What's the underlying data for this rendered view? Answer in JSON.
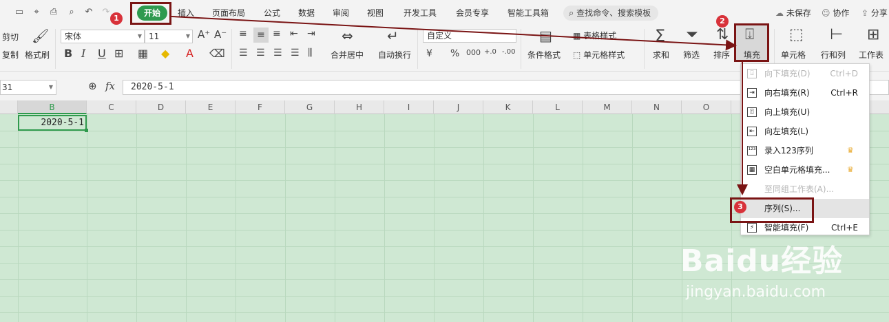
{
  "tabs": {
    "home": "开始",
    "insert": "插入",
    "page_layout": "页面布局",
    "formula": "公式",
    "data": "数据",
    "review": "审阅",
    "view": "视图",
    "developer": "开发工具",
    "member": "会员专享",
    "smart_toolbox": "智能工具箱"
  },
  "search": {
    "label": "查找命令、搜索模板"
  },
  "right_tools": {
    "unsaved": "未保存",
    "collab": "协作",
    "share": "分享"
  },
  "ribbon": {
    "cut": "剪切",
    "copy": "复制",
    "format_painter": "格式刷",
    "font_name": "宋体",
    "font_size": "11",
    "merge_center": "合并居中",
    "wrap_text": "自动换行",
    "number_format": "自定义",
    "conditional_format": "条件格式",
    "table_style": "表格样式",
    "cell_style": "单元格样式",
    "sum": "求和",
    "filter": "筛选",
    "sort": "排序",
    "fill": "填充",
    "cell": "单元格",
    "row_col": "行和列",
    "worksheet": "工作表",
    "bold": "B",
    "italic": "I",
    "underline": "U",
    "currency": "¥",
    "percent": "%",
    "thousands": "000",
    "inc_decimal": "+.0",
    "dec_decimal": "-.00"
  },
  "formula_bar": {
    "name_box": "31",
    "fx": "fx",
    "value": "2020-5-1"
  },
  "columns": [
    "B",
    "C",
    "D",
    "E",
    "F",
    "G",
    "H",
    "I",
    "J",
    "K",
    "L",
    "M",
    "N",
    "O"
  ],
  "cell_b1": "2020-5-1",
  "fill_menu": [
    {
      "label": "向下填充(D)",
      "shortcut": "Ctrl+D",
      "disabled": true
    },
    {
      "label": "向右填充(R)",
      "shortcut": "Ctrl+R",
      "disabled": false
    },
    {
      "label": "向上填充(U)",
      "shortcut": "",
      "disabled": false
    },
    {
      "label": "向左填充(L)",
      "shortcut": "",
      "disabled": false
    },
    {
      "label": "录入123序列",
      "shortcut": "",
      "disabled": false,
      "crown": true
    },
    {
      "label": "空白单元格填充...",
      "shortcut": "",
      "disabled": false,
      "crown": true
    },
    {
      "label": "至同组工作表(A)...",
      "shortcut": "",
      "disabled": true
    },
    {
      "label": "序列(S)...",
      "shortcut": "",
      "disabled": false,
      "highlighted": true
    },
    {
      "label": "智能填充(F)",
      "shortcut": "Ctrl+E",
      "disabled": false
    }
  ],
  "annotations": {
    "step1": "1",
    "step2": "2",
    "step3": "3"
  },
  "watermark": {
    "main": "Baidu经验",
    "sub": "jingyan.baidu.com"
  },
  "colors": {
    "accent": "#2e9a4f",
    "grid_bg": "#cfe8d3",
    "annotation": "#7a1414",
    "badge": "#d8323a"
  }
}
